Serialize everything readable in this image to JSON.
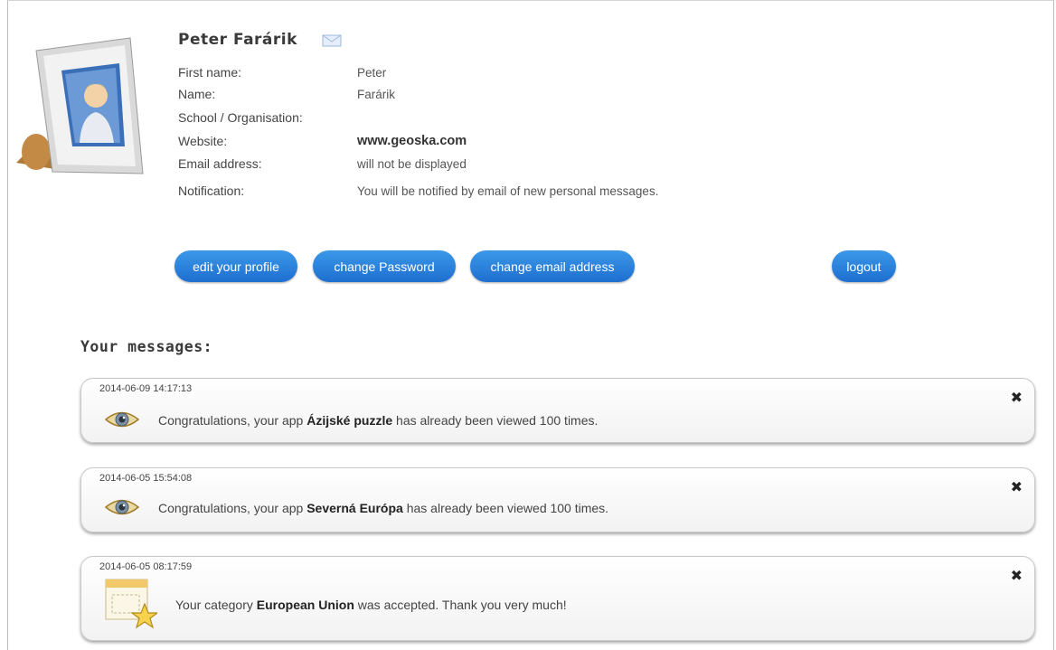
{
  "profile": {
    "name": "Peter Farárik",
    "fields": [
      {
        "label": "First name:",
        "value": "Peter"
      },
      {
        "label": "Name:",
        "value": "Farárik"
      },
      {
        "label": "School / Organisation:",
        "value": ""
      },
      {
        "label": "Website:",
        "value": "www.geoska.com"
      },
      {
        "label": "Email address:",
        "value": "will not be displayed"
      },
      {
        "label": "Notification:",
        "value": "You will be notified by email of new personal messages."
      }
    ]
  },
  "actions": {
    "edit_profile": "edit your profile",
    "change_password": "change Password",
    "change_email": "change email address",
    "logout": "logout"
  },
  "messages_section": {
    "title": "Your messages:",
    "items": [
      {
        "time": "2014-06-09 14:17:13",
        "icon": "eye-icon",
        "prefix": "Congratulations, your app ",
        "highlight": "Ázijské puzzle",
        "suffix": " has already been viewed 100 times."
      },
      {
        "time": "2014-06-05 15:54:08",
        "icon": "eye-icon",
        "prefix": "Congratulations, your app ",
        "highlight": "Severná Európa",
        "suffix": " has already been viewed 100 times."
      },
      {
        "time": "2014-06-05 08:17:59",
        "icon": "category-star-icon",
        "prefix": "Your category ",
        "highlight": "European Union",
        "suffix": " was accepted. Thank you very much!"
      }
    ],
    "close_symbol": "✖"
  },
  "colors": {
    "button": "#2a80dc",
    "text": "#444444"
  }
}
